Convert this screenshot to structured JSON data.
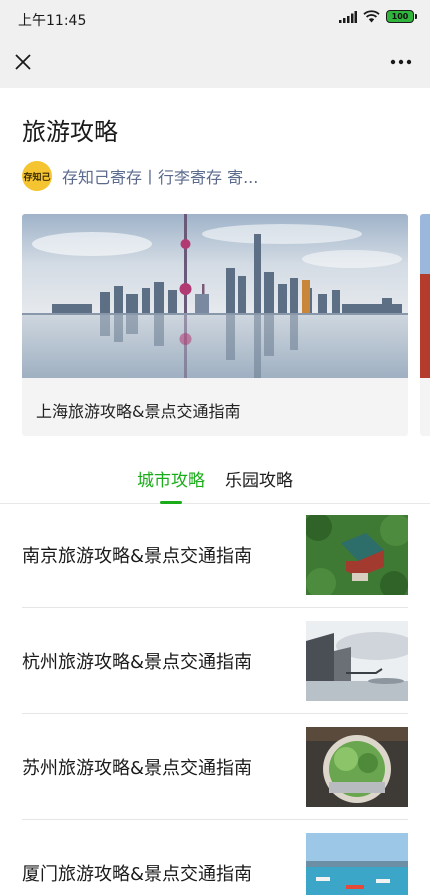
{
  "status_bar": {
    "time": "上午11:45",
    "battery": "100"
  },
  "page": {
    "title": "旅游攻略",
    "account_badge": "存知己",
    "account_name": "存知己寄存丨行李寄存 寄..."
  },
  "banner": {
    "caption": "上海旅游攻略&景点交通指南"
  },
  "tabs": [
    {
      "label": "城市攻略",
      "active": true
    },
    {
      "label": "乐园攻略",
      "active": false
    }
  ],
  "articles": [
    {
      "title": "南京旅游攻略&景点交通指南"
    },
    {
      "title": "杭州旅游攻略&景点交通指南"
    },
    {
      "title": "苏州旅游攻略&景点交通指南"
    },
    {
      "title": "厦门旅游攻略&景点交通指南"
    }
  ],
  "colors": {
    "accent": "#1aad19",
    "account_link": "#5a6a8c",
    "avatar": "#f4c531"
  },
  "icons": {
    "close": "close-icon",
    "more": "more-icon",
    "signal": "signal-icon",
    "wifi": "wifi-icon",
    "battery": "battery-icon"
  }
}
